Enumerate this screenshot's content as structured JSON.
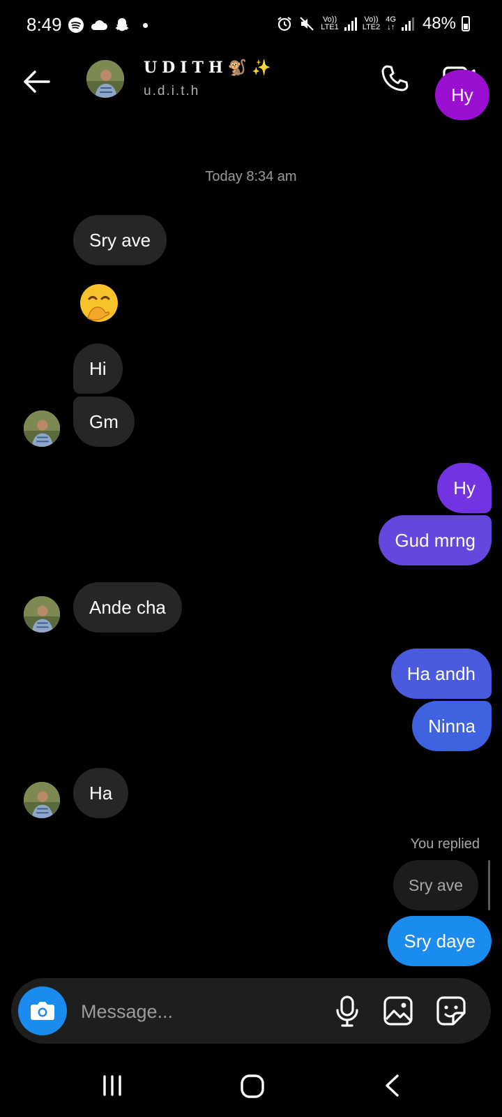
{
  "status_bar": {
    "time": "8:49",
    "net1_top": "Vo))",
    "net1_bottom": "LTE1",
    "net2_top": "Vo))",
    "net2_bottom": "LTE2",
    "net3_top": "4G",
    "net3_bottom": "↓↑",
    "battery": "48%"
  },
  "header": {
    "name": "UDITH🐒✨",
    "handle": "u.d.i.t.h"
  },
  "chat": {
    "top_partial": "Hy",
    "timestamp": "Today 8:34 am",
    "messages": [
      {
        "dir": "in",
        "text": "Sry ave"
      },
      {
        "dir": "in",
        "text": "🤭"
      },
      {
        "dir": "in",
        "text": "Hi"
      },
      {
        "dir": "in",
        "text": "Gm"
      },
      {
        "dir": "out",
        "text": "Hy"
      },
      {
        "dir": "out",
        "text": "Gud mrng"
      },
      {
        "dir": "in",
        "text": "Ande cha"
      },
      {
        "dir": "out",
        "text": "Ha andh"
      },
      {
        "dir": "out",
        "text": "Ninna"
      },
      {
        "dir": "in",
        "text": "Ha"
      },
      {
        "dir": "out",
        "text": "Sry daye"
      }
    ],
    "replied_label": "You replied",
    "reply_quote": "Sry ave"
  },
  "composer": {
    "placeholder": "Message..."
  },
  "colors": {
    "bubble_in": "#262626",
    "out_purple": "#7b2ee0",
    "out_violet": "#6d45de",
    "out_indigo": "#5c52dd",
    "out_blue_a": "#4a5de0",
    "out_blue_b": "#3f66e0",
    "out_blue": "#1a8cf0",
    "top_magenta": "#9b0fd1"
  },
  "icons": [
    "back-arrow-icon",
    "phone-icon",
    "video-camera-icon",
    "camera-icon",
    "microphone-icon",
    "gallery-icon",
    "sticker-icon",
    "recent-apps-icon",
    "home-icon",
    "nav-back-icon"
  ]
}
